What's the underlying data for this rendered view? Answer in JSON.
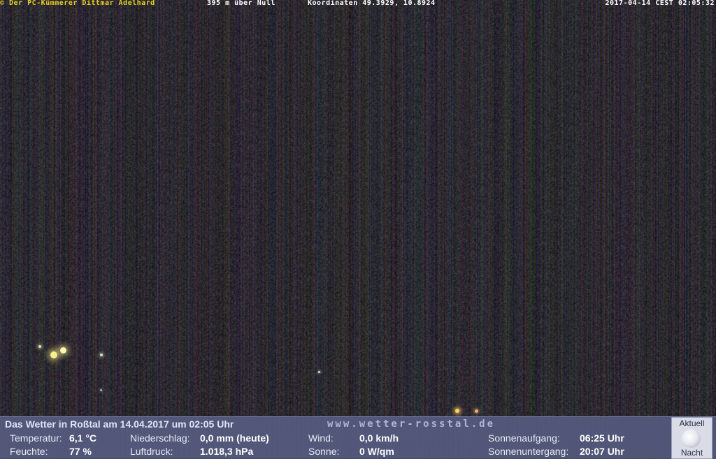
{
  "overlay": {
    "copyright": "© Der PC-Kümmerer Dittmar Adelhard",
    "altitude": "395 m über Null",
    "coordinates": "Koordinaten 49.3929, 10.8924",
    "timestamp": "2017-04-14 CEST 02:05:32"
  },
  "panel": {
    "title": "Das Wetter in Roßtal am 14.04.2017 um 02:05 Uhr",
    "url": "www.wetter-rosstal.de",
    "temperature_label": "Temperatur:",
    "temperature_value": "6,1 °C",
    "humidity_label": "Feuchte:",
    "humidity_value": "77 %",
    "precip_label": "Niederschlag:",
    "precip_value": "0,0 mm (heute)",
    "pressure_label": "Luftdruck:",
    "pressure_value": "1.018,3 hPa",
    "wind_label": "Wind:",
    "wind_value": "0,0 km/h",
    "sun_label": "Sonne:",
    "sun_value": "0 W/qm",
    "sunrise_label": "Sonnenaufgang:",
    "sunrise_value": "06:25 Uhr",
    "sunset_label": "Sonnenuntergang:",
    "sunset_value": "20:07 Uhr"
  },
  "moon": {
    "label_top": "Aktuell",
    "label_bottom": "Nacht",
    "icon": "full-moon-icon"
  }
}
